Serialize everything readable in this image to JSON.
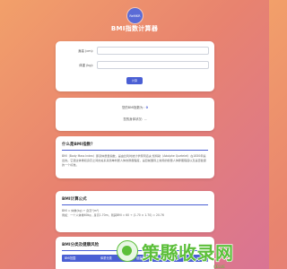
{
  "header": {
    "logo_text": "ReMKR",
    "title": "BMI指数计算器"
  },
  "form": {
    "height_label": "身高 (cm):",
    "weight_label": "体重 (kg):",
    "height_value": "",
    "weight_value": "",
    "submit_label": "计算"
  },
  "result": {
    "bmi_label": "您的BMI指数为：",
    "bmi_value": "0",
    "status_label": "您的身体状况：",
    "status_value": "--"
  },
  "sections": {
    "what_title": "什么是BMI指数？",
    "what_body": "BMI（Body Mass Index）即身体质量指数，是由比利时统计学家阿道夫·凯特勒（Adolphe Quetelet）在1830年提出的。它通过体重和身高之间的关系来简单判断人体的胖瘦程度，是目前国际上常用的衡量人体胖瘦程度以及是否健康的一个标准。",
    "formula_title": "BMI计算公式",
    "formula_line1": "BMI = 体重(kg) ÷ 身高²(m²)",
    "formula_line2": "例如：一个人体重60kg，身高1.70m，则其BMI = 60 ÷ (1.70 × 1.70) = 20.76",
    "table_title": "BMI分类及健康风险",
    "table_headers": [
      "BMI范围",
      "体重分类",
      "健康风险"
    ]
  },
  "watermark": {
    "text": "策縣收录网",
    "sub": "CELUE"
  },
  "colors": {
    "accent": "#4a5fd4",
    "bg_start": "#f2a06a",
    "bg_end": "#d97494",
    "watermark": "#5cbf3a"
  }
}
